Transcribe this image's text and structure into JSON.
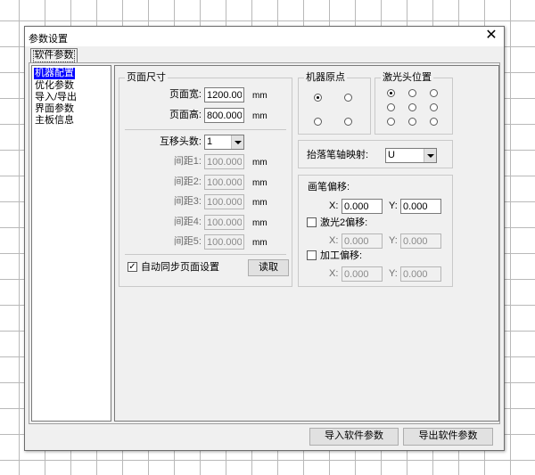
{
  "window": {
    "title": "参数设置",
    "close_glyph": "✕"
  },
  "tab": {
    "label": "软件参数"
  },
  "tree": {
    "items": [
      "机器配置",
      "优化参数",
      "导入/导出",
      "界面参数",
      "主板信息"
    ],
    "selected": 0
  },
  "page_size": {
    "title": "页面尺寸",
    "width_label": "页面宽:",
    "width_value": "1200.000",
    "height_label": "页面高:",
    "height_value": "800.000",
    "unit": "mm"
  },
  "heads": {
    "count_label": "互移头数:",
    "count_value": "1",
    "gaps": [
      {
        "label": "间距1:",
        "value": "100.000"
      },
      {
        "label": "间距2:",
        "value": "100.000"
      },
      {
        "label": "间距3:",
        "value": "100.000"
      },
      {
        "label": "间距4:",
        "value": "100.000"
      },
      {
        "label": "间距5:",
        "value": "100.000"
      }
    ]
  },
  "sync": {
    "label": "自动同步页面设置",
    "checked": true,
    "check_glyph": "✓",
    "read_button": "读取"
  },
  "origin": {
    "title": "机器原点"
  },
  "laser_pos": {
    "title": "激光头位置"
  },
  "pen_axis": {
    "label": "抬落笔轴映射:",
    "value": "U"
  },
  "offsets": {
    "pen": {
      "label": "画笔偏移:",
      "x": "0.000",
      "y": "0.000"
    },
    "laser2": {
      "label": "激光2偏移:",
      "x": "0.000",
      "y": "0.000"
    },
    "process": {
      "label": "加工偏移:",
      "x": "0.000",
      "y": "0.000"
    },
    "x_label": "X:",
    "y_label": "Y:"
  },
  "footer": {
    "import_button": "导入软件参数",
    "export_button": "导出软件参数"
  }
}
